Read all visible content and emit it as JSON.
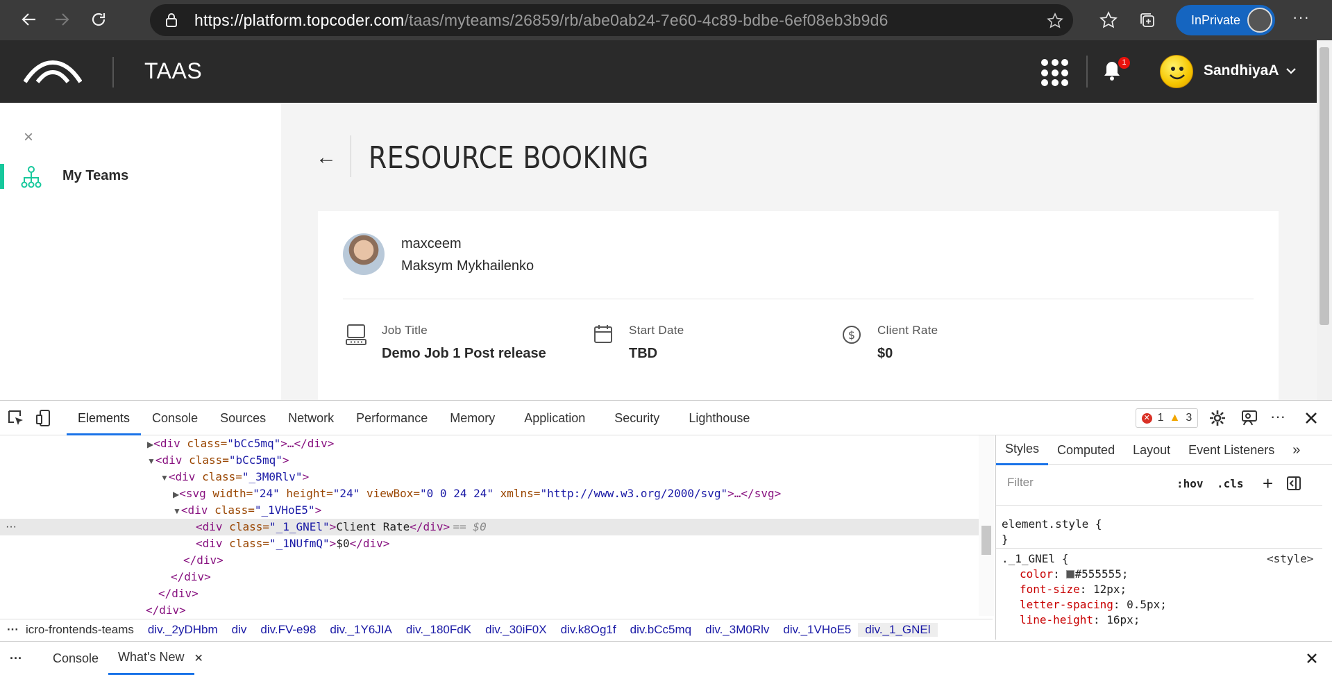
{
  "browser": {
    "url_domain": "https://platform.topcoder.com",
    "url_path": "/taas/myteams/26859/rb/abe0ab24-7e60-4c89-bdbe-6ef08eb3b9d6",
    "inprivate_label": "InPrivate",
    "more": "···"
  },
  "app": {
    "title": "TAAS",
    "notification_count": "1",
    "user_name": "SandhiyaA"
  },
  "sidebar": {
    "close": "×",
    "items": [
      {
        "label": "My Teams"
      }
    ]
  },
  "main": {
    "back": "←",
    "title": "RESOURCE BOOKING",
    "member": {
      "handle": "maxceem",
      "name": "Maksym Mykhailenko"
    },
    "fields": [
      {
        "label": "Job Title",
        "value": "Demo Job 1 Post release",
        "icon": "computer-icon"
      },
      {
        "label": "Start Date",
        "value": "TBD",
        "icon": "calendar-icon"
      },
      {
        "label": "Client Rate",
        "value": "$0",
        "icon": "dollar-icon"
      }
    ]
  },
  "devtools": {
    "tabs": [
      "Elements",
      "Console",
      "Sources",
      "Network",
      "Performance",
      "Memory",
      "Application",
      "Security",
      "Lighthouse"
    ],
    "errors": "1",
    "warnings": "3",
    "dom_lines": [
      {
        "open": "▶",
        "tag": "<div ",
        "attr": "class=",
        "val": "\"bCc5mq\"",
        "rest": ">…</div>"
      },
      {
        "open": "▼",
        "tag": "<div ",
        "attr": "class=",
        "val": "\"bCc5mq\"",
        "rest": ">"
      },
      {
        "open": "▼",
        "tag": "<div ",
        "attr": "class=",
        "val": "\"_3M0Rlv\"",
        "rest": ">"
      },
      {
        "open": "▶",
        "tag": "<svg ",
        "attr": "width=",
        "val": "\"24\"",
        "rest": ""
      },
      {
        "open": "▼",
        "tag": "<div ",
        "attr": "class=",
        "val": "\"_1VHoE5\"",
        "rest": ">"
      },
      {
        "open": "",
        "tag": "<div ",
        "attr": "class=",
        "val": "\"_1_GNEl\"",
        "rest": ">"
      },
      {
        "open": "",
        "tag": "<div ",
        "attr": "class=",
        "val": "\"_1NUfmQ\"",
        "rest": ">"
      },
      {
        "open": "",
        "tag": "</div>",
        "attr": "",
        "val": "",
        "rest": ""
      },
      {
        "open": "",
        "tag": "</div>",
        "attr": "",
        "val": "",
        "rest": ""
      },
      {
        "open": "",
        "tag": "</div>",
        "attr": "",
        "val": "",
        "rest": ""
      },
      {
        "open": "",
        "tag": "</div>",
        "attr": "",
        "val": "",
        "rest": ""
      }
    ],
    "svg_attrs": {
      "height": "\"24\"",
      "viewBox": "\"0 0 24 24\"",
      "xmlns": "\"http://www.w3.org/2000/svg\"",
      "rest": ">…</svg>"
    },
    "selected_text": "Client Rate",
    "selected_close": "</div>",
    "selected_marker": "== $0",
    "next_text": "$0",
    "next_close": "</div>",
    "breadcrumbs": [
      "icro-frontends-teams",
      "div._2yDHbm",
      "div",
      "div.FV-e98",
      "div._1Y6JIA",
      "div._180FdK",
      "div._30iF0X",
      "div.k8Og1f",
      "div.bCc5mq",
      "div._3M0Rlv",
      "div._1VHoE5",
      "div._1_GNEl"
    ],
    "style_tabs": [
      "Styles",
      "Computed",
      "Layout",
      "Event Listeners"
    ],
    "filter_placeholder": "Filter",
    "hov": ":hov",
    "cls": ".cls",
    "element_style": "element.style {",
    "close_brace": "}",
    "rule_selector": "._1_GNEl {",
    "rule_source": "<style>",
    "props": [
      {
        "name": "color",
        "value": "#555555;"
      },
      {
        "name": "font-size",
        "value": "12px;"
      },
      {
        "name": "letter-spacing",
        "value": "0.5px;"
      },
      {
        "name": "line-height",
        "value": "16px;"
      }
    ],
    "drawer_tabs": [
      "Console",
      "What's New"
    ]
  },
  "colors": {
    "accent": "#16c89c",
    "devtools_blue": "#1a73e8",
    "header_bg": "#2a2a2a"
  }
}
